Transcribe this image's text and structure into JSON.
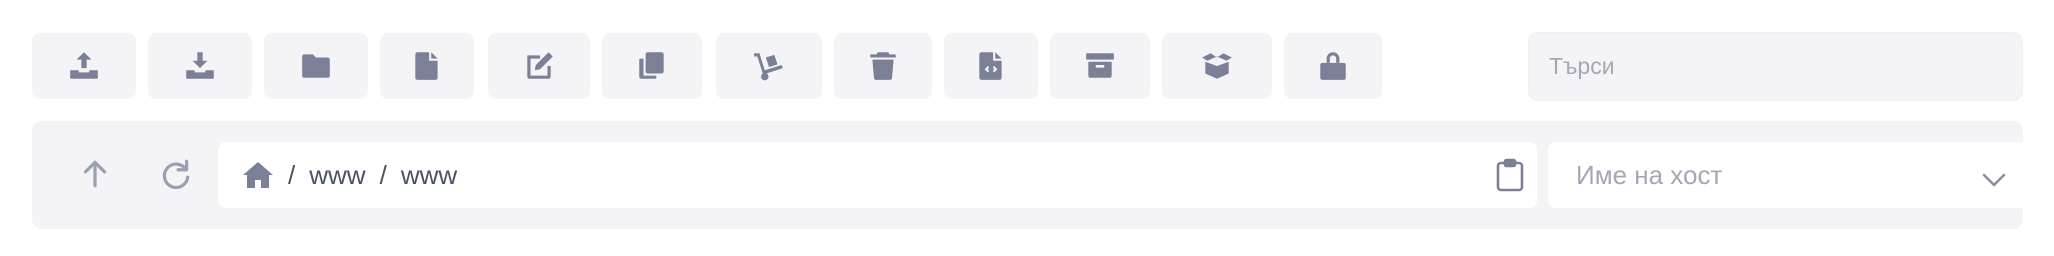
{
  "toolbar": {
    "buttons": [
      {
        "name": "upload-button",
        "icon": "upload-icon"
      },
      {
        "name": "download-button",
        "icon": "download-icon"
      },
      {
        "name": "new-folder-button",
        "icon": "folder-icon"
      },
      {
        "name": "new-file-button",
        "icon": "file-icon"
      },
      {
        "name": "edit-button",
        "icon": "edit-icon"
      },
      {
        "name": "copy-button",
        "icon": "copy-icon"
      },
      {
        "name": "move-button",
        "icon": "hand-truck-icon"
      },
      {
        "name": "delete-button",
        "icon": "trash-icon"
      },
      {
        "name": "code-button",
        "icon": "file-code-icon"
      },
      {
        "name": "archive-button",
        "icon": "archive-icon"
      },
      {
        "name": "extract-button",
        "icon": "open-box-icon"
      },
      {
        "name": "permissions-button",
        "icon": "lock-icon"
      }
    ]
  },
  "search": {
    "placeholder": "Търси",
    "value": ""
  },
  "pathbar": {
    "up_icon": "arrow-up-icon",
    "refresh_icon": "refresh-icon",
    "home_icon": "home-icon",
    "separator": "/",
    "segments": [
      "www",
      "www"
    ],
    "clipboard_icon": "clipboard-icon"
  },
  "host_select": {
    "placeholder": "Име на хост",
    "chevron_icon": "chevron-down-icon"
  },
  "colors": {
    "button_bg": "#f4f4f6",
    "icon": "#7c8096",
    "placeholder": "#a4a8b5"
  }
}
